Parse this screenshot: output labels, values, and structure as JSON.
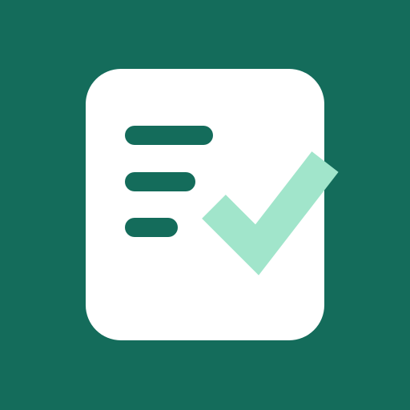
{
  "icon": {
    "name": "checklist-app-icon",
    "background_color": "#146c5b",
    "card_color": "#ffffff",
    "line_color": "#146c5b",
    "check_color": "#a1e5cb",
    "card_icon": "document-icon",
    "check_icon": "checkmark-icon",
    "lines": [
      {
        "name": "text-line-1"
      },
      {
        "name": "text-line-2"
      },
      {
        "name": "text-line-3"
      }
    ]
  }
}
